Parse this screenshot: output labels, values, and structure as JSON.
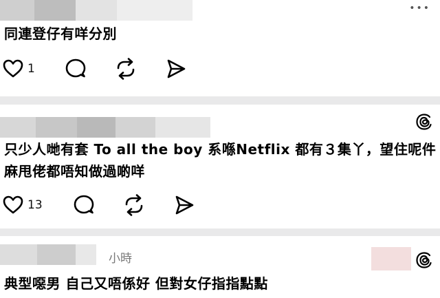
{
  "posts": [
    {
      "text": "同連登仔有咩分別",
      "like_count": "1",
      "more_label": "•••"
    },
    {
      "text_line1": "只少人哋有套 To all the boy 系喺Netflix 都有３集丫，望住呢件",
      "text_line2": "麻甩佬都唔知做過啲咩",
      "like_count": "13"
    },
    {
      "time": "小時",
      "text": "典型噁男 自己又唔係好 但對女仔指指點點"
    }
  ],
  "icons": [
    "heart-icon",
    "comment-icon",
    "repost-icon",
    "share-icon",
    "threads-logo-icon"
  ]
}
